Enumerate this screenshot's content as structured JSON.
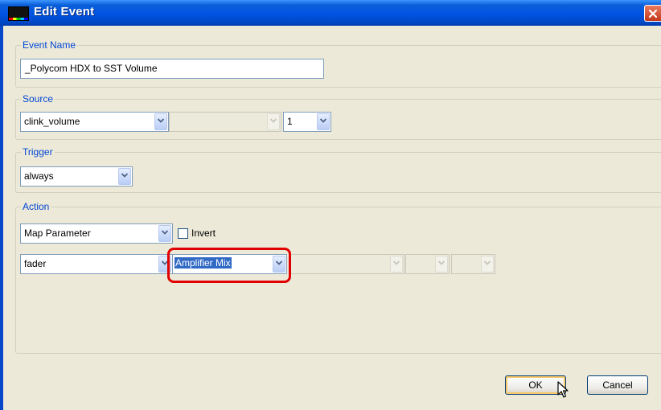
{
  "window": {
    "title": "Edit Event"
  },
  "event_name": {
    "legend": "Event Name",
    "value": "_Polycom HDX to SST Volume"
  },
  "source": {
    "legend": "Source",
    "object": "clink_volume",
    "secondary": "",
    "channel": "1"
  },
  "trigger": {
    "legend": "Trigger",
    "value": "always"
  },
  "action": {
    "legend": "Action",
    "type": "Map Parameter",
    "invert_label": "Invert",
    "invert_checked": false,
    "parameter": "fader",
    "target": "Amplifier Mix",
    "highlight_color": "#e00000"
  },
  "buttons": {
    "ok": "OK",
    "cancel": "Cancel"
  },
  "colors": {
    "titlebar": "#0054e3",
    "client": "#ece9d8",
    "legend": "#0046d5",
    "selection": "#316ac5"
  }
}
